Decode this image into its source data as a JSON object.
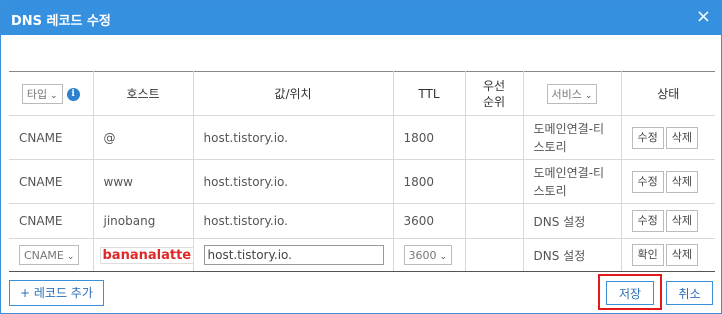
{
  "dialog": {
    "title": "DNS 레코드 수정",
    "close_label": "×"
  },
  "table": {
    "headers": {
      "type_select": "타입",
      "info_icon": "i",
      "host": "호스트",
      "value": "값/위치",
      "ttl": "TTL",
      "priority_line1": "우선",
      "priority_line2": "순위",
      "service_select": "서비스",
      "status": "상태"
    },
    "rows": [
      {
        "type": "CNAME",
        "host": "@",
        "value": "host.tistory.io.",
        "ttl": "1800",
        "priority": "",
        "service_line1": "도메인연결-티",
        "service_line2": "스토리",
        "btn1": "수정",
        "btn2": "삭제"
      },
      {
        "type": "CNAME",
        "host": "www",
        "value": "host.tistory.io.",
        "ttl": "1800",
        "priority": "",
        "service_line1": "도메인연결-티",
        "service_line2": "스토리",
        "btn1": "수정",
        "btn2": "삭제"
      },
      {
        "type": "CNAME",
        "host": "jinobang",
        "value": "host.tistory.io.",
        "ttl": "3600",
        "priority": "",
        "service": "DNS 설정",
        "btn1": "수정",
        "btn2": "삭제"
      }
    ],
    "edit_row": {
      "type_value": "CNAME",
      "host_value": "bananalatte",
      "value_input": "host.tistory.io.",
      "ttl_value": "3600",
      "service": "DNS 설정",
      "btn1": "확인",
      "btn2": "삭제"
    }
  },
  "footer": {
    "add_record_label": "+ 레코드 추가",
    "save_label": "저장",
    "cancel_label": "취소"
  },
  "colors": {
    "header_blue": "#3591e0",
    "accent_red": "#e21a1a",
    "button_blue": "#2a6fb8"
  }
}
